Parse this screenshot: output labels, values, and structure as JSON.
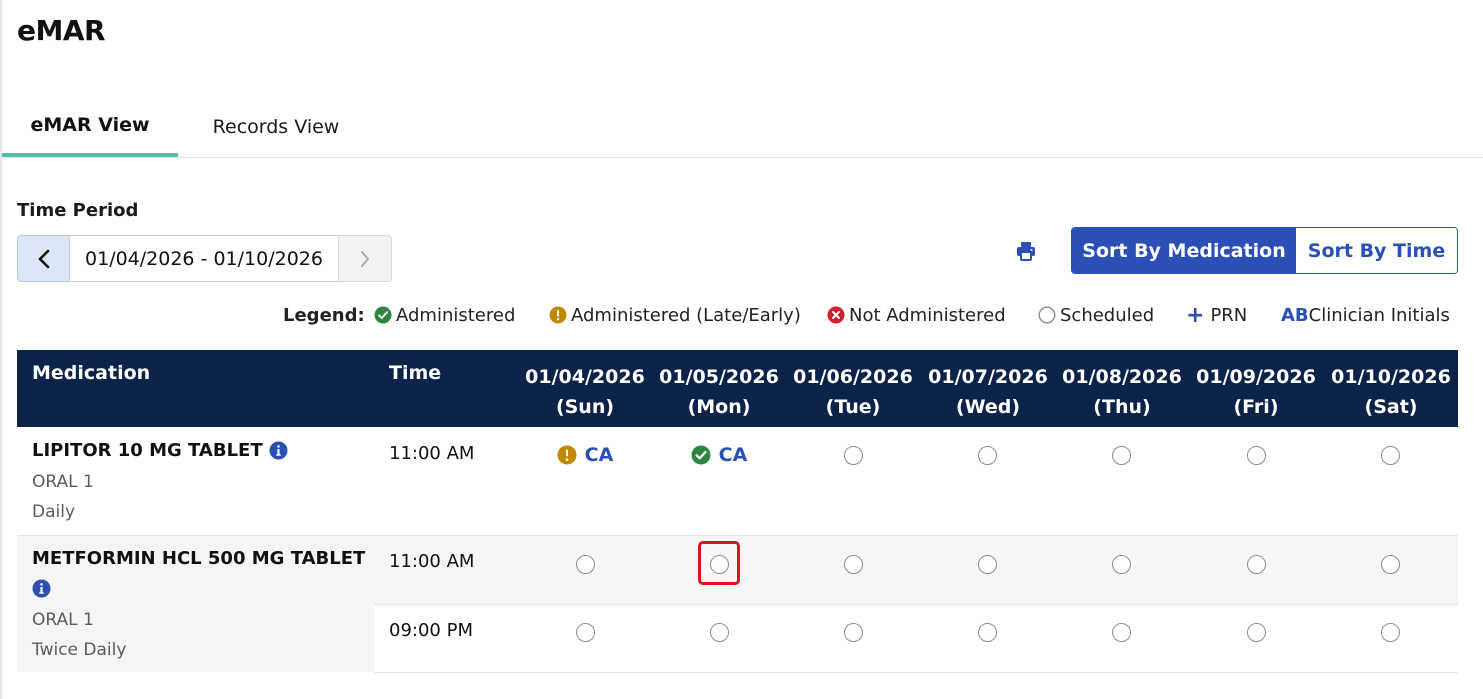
{
  "app": {
    "title": "eMAR"
  },
  "tabs": [
    {
      "label": "eMAR View",
      "active": true
    },
    {
      "label": "Records View",
      "active": false
    }
  ],
  "time_period": {
    "label": "Time Period",
    "range": "01/04/2026 - 01/10/2026"
  },
  "sort": {
    "by_medication": "Sort By Medication",
    "by_time": "Sort By Time",
    "active": "by_medication"
  },
  "legend": {
    "title": "Legend:",
    "administered": "Administered",
    "late_early": "Administered (Late/Early)",
    "not_administered": "Not Administered",
    "scheduled": "Scheduled",
    "prn_symbol": "+",
    "prn": "PRN",
    "initials_abbr": "AB",
    "initials": "Clinician Initials"
  },
  "grid": {
    "headers": {
      "medication": "Medication",
      "time": "Time",
      "dates": [
        {
          "date": "01/04/2026",
          "day": "(Sun)"
        },
        {
          "date": "01/05/2026",
          "day": "(Mon)"
        },
        {
          "date": "01/06/2026",
          "day": "(Tue)"
        },
        {
          "date": "01/07/2026",
          "day": "(Wed)"
        },
        {
          "date": "01/08/2026",
          "day": "(Thu)"
        },
        {
          "date": "01/09/2026",
          "day": "(Fri)"
        },
        {
          "date": "01/10/2026",
          "day": "(Sat)"
        }
      ]
    },
    "medications": [
      {
        "name": "LIPITOR 10 MG TABLET",
        "route": "ORAL 1",
        "frequency": "Daily",
        "doses": [
          {
            "time": "11:00 AM",
            "cells": [
              "late_early:CA",
              "administered:CA",
              "scheduled",
              "scheduled",
              "scheduled",
              "scheduled",
              "scheduled"
            ]
          }
        ]
      },
      {
        "name": "METFORMIN HCL 500 MG TABLET",
        "route": "ORAL 1",
        "frequency": "Twice Daily",
        "doses": [
          {
            "time": "11:00 AM",
            "cells": [
              "scheduled",
              "scheduled",
              "scheduled",
              "scheduled",
              "scheduled",
              "scheduled",
              "scheduled"
            ]
          },
          {
            "time": "09:00 PM",
            "cells": [
              "scheduled",
              "scheduled",
              "scheduled",
              "scheduled",
              "scheduled",
              "scheduled",
              "scheduled"
            ]
          }
        ]
      }
    ]
  },
  "colors": {
    "brand_blue": "#2b4fb5",
    "header_navy": "#0b2349",
    "tab_accent": "#4fbfb2",
    "administered": "#2e8540",
    "late_early": "#c08a00",
    "not_administered": "#d21f2b",
    "highlight": "#e0141c"
  },
  "icons": {
    "prev": "chevron-left-icon",
    "next": "chevron-right-icon",
    "print": "printer-icon",
    "info": "info-icon"
  }
}
